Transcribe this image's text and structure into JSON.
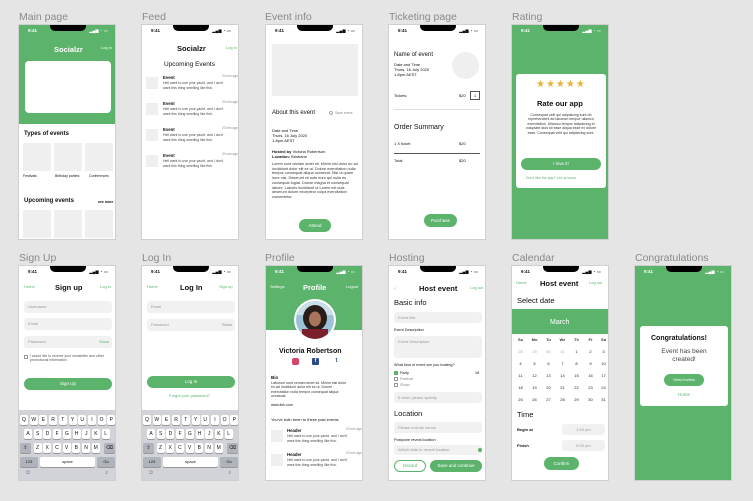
{
  "labels": {
    "main": "Main page",
    "feed": "Feed",
    "event": "Event info",
    "ticket": "Ticketing page",
    "rating": "Rating",
    "signup": "Sign Up",
    "login": "Log In",
    "profile": "Profile",
    "hosting": "Hosting",
    "calendar": "Calendar",
    "congrats": "Congratulations"
  },
  "status": {
    "time": "9:41"
  },
  "main": {
    "brand": "Socialzr",
    "login": "Log in",
    "types": "Types of events",
    "t1": "Festivals",
    "t2": "Birthday parties",
    "t3": "Conferences",
    "upcoming": "Upcoming events",
    "seemore": "see more"
  },
  "feed": {
    "brand": "Socialzr",
    "login": "Log in",
    "title": "Upcoming Events",
    "item_title": "Event",
    "item_time": "20 min ago",
    "item_text1": "Hell want to use your yacht, and I don't",
    "item_text2": "want this thing smelling like fish."
  },
  "event": {
    "about": "About this event",
    "save": "Save event",
    "dt_label": "Date and Time",
    "dt1": "Thurs, 16 July 2020",
    "dt2": "1-8pm AEST",
    "hosted_label": "Hosted by",
    "hosted": "Victoria Robertson",
    "loc_label": "Location:",
    "loc": "Brisbane",
    "desc": "Lorem sunt veniam amet sit. Minim nisi dolor eu ad incididunt dolor elit ex ut. Dolore exercitation nulla tempor consequat aliqua occaecat. Nisi ut quam irure nisi. Deserunt sit aute irure qui nulla eu consequat fugiat. Dolore magna et consequat labore. Laboris incididunt ut Lorem est duis deserunt dolore excepteur culpa exercitation consectetur.",
    "attend": "Attend"
  },
  "ticket": {
    "name": "Name of event",
    "dt_label": "Date and Time",
    "dt1": "Thurs, 16 July 2020",
    "dt2": "1-8pm AEST",
    "tickets": "Tickets",
    "price": "$20",
    "qty": "1",
    "summary": "Order Summary",
    "line": "1 X ticket",
    "line_price": "$20",
    "total": "Total",
    "total_price": "$20",
    "purchase": "Purchase"
  },
  "rating": {
    "title": "Rate our app",
    "text": "Consequat velit qui adipisicing sunt do reprehenderit ad laborum tempor ullamco exercitation. Ullamco tempor adipisicing et voluptate duis sit esse aliqua esse ex dolore esse. Consequat velit qui adipisicing sunt.",
    "love": "I love it!",
    "dont": "Don't like the app? Let us know."
  },
  "signup": {
    "home": "Home",
    "title": "Sign up",
    "log": "Log in",
    "user": "Username",
    "email": "Email",
    "pass": "Password",
    "show": "Show",
    "terms": "I would like to receive your newsletter and other promotional information.",
    "btn": "Sign Up"
  },
  "login": {
    "home": "Home",
    "title": "Log In",
    "sign": "Sign up",
    "email": "Email",
    "pass": "Password",
    "show": "Show",
    "btn": "Log In",
    "forgot": "Forgot your password?"
  },
  "keyboard": {
    "r1": [
      "Q",
      "W",
      "E",
      "R",
      "T",
      "Y",
      "U",
      "I",
      "O",
      "P"
    ],
    "r2": [
      "A",
      "S",
      "D",
      "F",
      "G",
      "H",
      "J",
      "K",
      "L"
    ],
    "r3": [
      "Z",
      "X",
      "C",
      "V",
      "B",
      "N",
      "M"
    ],
    "num": "123",
    "space": "space",
    "go": "Go"
  },
  "profile": {
    "settings": "Settings",
    "title": "Profile",
    "logout": "Logout",
    "name": "Victoria Robertson",
    "bio": "Bio",
    "bio_text": "Laborum sunt veniam amet sit. Minim nisi dolor eu ad incididunt dolor elit ex ut. Dolore exercitation nulla tempor consequat aliqua occaecat.",
    "site": "www.link.com",
    "past": "You've both been to these past events",
    "item_title": "Header",
    "item_time": "20 min ago",
    "item_text1": "Hell want to use your yacht, and I don't",
    "item_text2": "want this thing smelling like fish."
  },
  "hosting": {
    "title": "Host event",
    "logout": "Log out",
    "basic": "Basic info",
    "name": "Event title",
    "desc_label": "Event Description",
    "desc": "Event Description",
    "kind_q": "What kind of event are you hosting?",
    "opt1": "Party",
    "opt2": "Festival",
    "opt3": "Show",
    "other": "If other please specify",
    "location": "Location",
    "loc_ph": "Please include venue",
    "reveal": "Postpone reveal location",
    "reveal_ph": "Which date to reveal location",
    "discard": "Discard",
    "save": "Save and continue",
    "count": "18"
  },
  "calendar": {
    "home": "Home",
    "title": "Host event",
    "logout": "Log out",
    "select": "Select date",
    "month": "March",
    "days": [
      "Su",
      "Mo",
      "Tu",
      "We",
      "Th",
      "Fr",
      "Sa"
    ],
    "weeks": [
      [
        "28",
        "29",
        "30",
        "31",
        "1",
        "2",
        "3"
      ],
      [
        "4",
        "5",
        "6",
        "7",
        "8",
        "9",
        "10"
      ],
      [
        "11",
        "12",
        "13",
        "14",
        "15",
        "16",
        "17"
      ],
      [
        "18",
        "19",
        "20",
        "21",
        "22",
        "23",
        "24"
      ],
      [
        "25",
        "26",
        "27",
        "28",
        "29",
        "30",
        "31"
      ]
    ],
    "time": "Time",
    "begin": "Begin at",
    "begin_val": "1:00 pm",
    "finish": "Finish",
    "finish_val": "8:00 pm",
    "confirm": "Confirm"
  },
  "congrats": {
    "title": "Congratulations!",
    "text": "Event has been created!",
    "btn": "Send invites",
    "home": "Home"
  }
}
